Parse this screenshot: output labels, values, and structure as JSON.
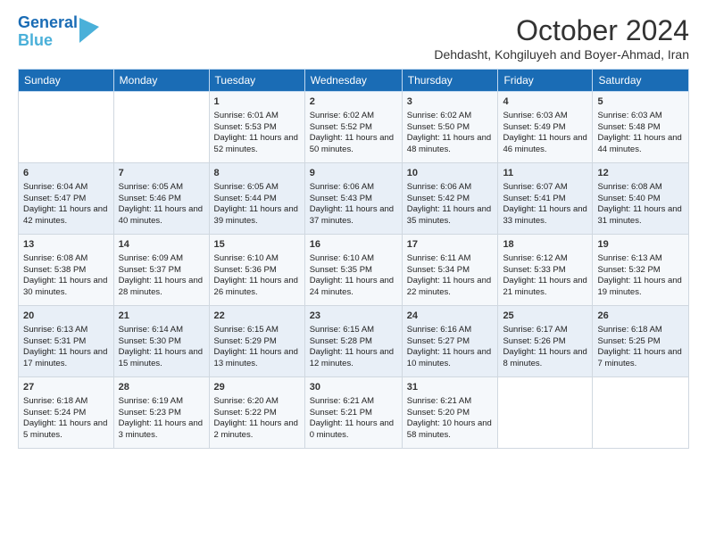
{
  "header": {
    "logo_line1": "General",
    "logo_line2": "Blue",
    "month": "October 2024",
    "location": "Dehdasht, Kohgiluyeh and Boyer-Ahmad, Iran"
  },
  "days_of_week": [
    "Sunday",
    "Monday",
    "Tuesday",
    "Wednesday",
    "Thursday",
    "Friday",
    "Saturday"
  ],
  "weeks": [
    [
      {
        "day": "",
        "info": ""
      },
      {
        "day": "",
        "info": ""
      },
      {
        "day": "1",
        "info": "Sunrise: 6:01 AM\nSunset: 5:53 PM\nDaylight: 11 hours and 52 minutes."
      },
      {
        "day": "2",
        "info": "Sunrise: 6:02 AM\nSunset: 5:52 PM\nDaylight: 11 hours and 50 minutes."
      },
      {
        "day": "3",
        "info": "Sunrise: 6:02 AM\nSunset: 5:50 PM\nDaylight: 11 hours and 48 minutes."
      },
      {
        "day": "4",
        "info": "Sunrise: 6:03 AM\nSunset: 5:49 PM\nDaylight: 11 hours and 46 minutes."
      },
      {
        "day": "5",
        "info": "Sunrise: 6:03 AM\nSunset: 5:48 PM\nDaylight: 11 hours and 44 minutes."
      }
    ],
    [
      {
        "day": "6",
        "info": "Sunrise: 6:04 AM\nSunset: 5:47 PM\nDaylight: 11 hours and 42 minutes."
      },
      {
        "day": "7",
        "info": "Sunrise: 6:05 AM\nSunset: 5:46 PM\nDaylight: 11 hours and 40 minutes."
      },
      {
        "day": "8",
        "info": "Sunrise: 6:05 AM\nSunset: 5:44 PM\nDaylight: 11 hours and 39 minutes."
      },
      {
        "day": "9",
        "info": "Sunrise: 6:06 AM\nSunset: 5:43 PM\nDaylight: 11 hours and 37 minutes."
      },
      {
        "day": "10",
        "info": "Sunrise: 6:06 AM\nSunset: 5:42 PM\nDaylight: 11 hours and 35 minutes."
      },
      {
        "day": "11",
        "info": "Sunrise: 6:07 AM\nSunset: 5:41 PM\nDaylight: 11 hours and 33 minutes."
      },
      {
        "day": "12",
        "info": "Sunrise: 6:08 AM\nSunset: 5:40 PM\nDaylight: 11 hours and 31 minutes."
      }
    ],
    [
      {
        "day": "13",
        "info": "Sunrise: 6:08 AM\nSunset: 5:38 PM\nDaylight: 11 hours and 30 minutes."
      },
      {
        "day": "14",
        "info": "Sunrise: 6:09 AM\nSunset: 5:37 PM\nDaylight: 11 hours and 28 minutes."
      },
      {
        "day": "15",
        "info": "Sunrise: 6:10 AM\nSunset: 5:36 PM\nDaylight: 11 hours and 26 minutes."
      },
      {
        "day": "16",
        "info": "Sunrise: 6:10 AM\nSunset: 5:35 PM\nDaylight: 11 hours and 24 minutes."
      },
      {
        "day": "17",
        "info": "Sunrise: 6:11 AM\nSunset: 5:34 PM\nDaylight: 11 hours and 22 minutes."
      },
      {
        "day": "18",
        "info": "Sunrise: 6:12 AM\nSunset: 5:33 PM\nDaylight: 11 hours and 21 minutes."
      },
      {
        "day": "19",
        "info": "Sunrise: 6:13 AM\nSunset: 5:32 PM\nDaylight: 11 hours and 19 minutes."
      }
    ],
    [
      {
        "day": "20",
        "info": "Sunrise: 6:13 AM\nSunset: 5:31 PM\nDaylight: 11 hours and 17 minutes."
      },
      {
        "day": "21",
        "info": "Sunrise: 6:14 AM\nSunset: 5:30 PM\nDaylight: 11 hours and 15 minutes."
      },
      {
        "day": "22",
        "info": "Sunrise: 6:15 AM\nSunset: 5:29 PM\nDaylight: 11 hours and 13 minutes."
      },
      {
        "day": "23",
        "info": "Sunrise: 6:15 AM\nSunset: 5:28 PM\nDaylight: 11 hours and 12 minutes."
      },
      {
        "day": "24",
        "info": "Sunrise: 6:16 AM\nSunset: 5:27 PM\nDaylight: 11 hours and 10 minutes."
      },
      {
        "day": "25",
        "info": "Sunrise: 6:17 AM\nSunset: 5:26 PM\nDaylight: 11 hours and 8 minutes."
      },
      {
        "day": "26",
        "info": "Sunrise: 6:18 AM\nSunset: 5:25 PM\nDaylight: 11 hours and 7 minutes."
      }
    ],
    [
      {
        "day": "27",
        "info": "Sunrise: 6:18 AM\nSunset: 5:24 PM\nDaylight: 11 hours and 5 minutes."
      },
      {
        "day": "28",
        "info": "Sunrise: 6:19 AM\nSunset: 5:23 PM\nDaylight: 11 hours and 3 minutes."
      },
      {
        "day": "29",
        "info": "Sunrise: 6:20 AM\nSunset: 5:22 PM\nDaylight: 11 hours and 2 minutes."
      },
      {
        "day": "30",
        "info": "Sunrise: 6:21 AM\nSunset: 5:21 PM\nDaylight: 11 hours and 0 minutes."
      },
      {
        "day": "31",
        "info": "Sunrise: 6:21 AM\nSunset: 5:20 PM\nDaylight: 10 hours and 58 minutes."
      },
      {
        "day": "",
        "info": ""
      },
      {
        "day": "",
        "info": ""
      }
    ]
  ]
}
